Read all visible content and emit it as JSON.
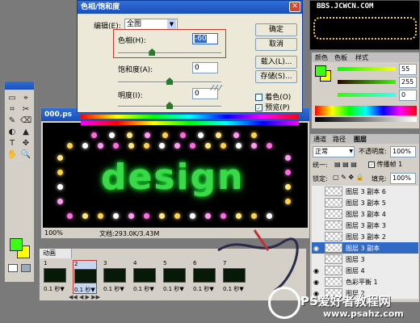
{
  "hue_dialog": {
    "title": "色相/饱和度",
    "edit_label": "编辑(E):",
    "edit_value": "全图",
    "hue_label": "色相(H):",
    "hue_value": "-60",
    "hue_level": 0.33,
    "saturation_label": "饱和度(A):",
    "saturation_value": "0",
    "saturation_level": 0.5,
    "lightness_label": "明度(I):",
    "lightness_value": "0",
    "lightness_level": 0.5,
    "ok_button": "确定",
    "cancel_button": "取消",
    "load_button": "载入(L)...",
    "save_button": "存储(S)...",
    "colorize_label": "着色(O)",
    "colorize_checked": false,
    "preview_label": "预览(P)",
    "preview_checked": true
  },
  "watermark_top": "BBS.JCWCN.COM",
  "document": {
    "title": "000.ps",
    "canvas_text": "design",
    "zoom": "100%",
    "doc_info": "文档:293.0K/3.43M"
  },
  "color_panel": {
    "tabs": [
      "颜色",
      "色板",
      "样式"
    ],
    "value_r": "55",
    "value_g": "255",
    "value_b": "0",
    "foreground": "#39ff14",
    "background": "#ffff00"
  },
  "layers_panel": {
    "tabs": [
      "通道",
      "路径",
      "图层"
    ],
    "blend_mode": "正常",
    "opacity_label": "不透明度:",
    "opacity_value": "100%",
    "unify_label": "统一:",
    "propagate_label": "传播帧 1",
    "lock_label": "锁定:",
    "fill_label": "填充:",
    "fill_value": "100%",
    "layers": [
      {
        "name": "图层 3 副本 6",
        "visible": false,
        "selected": false
      },
      {
        "name": "图层 3 副本 5",
        "visible": false,
        "selected": false
      },
      {
        "name": "图层 3 副本 4",
        "visible": false,
        "selected": false
      },
      {
        "name": "图层 3 副本 3",
        "visible": false,
        "selected": false
      },
      {
        "name": "图层 3 副本 2",
        "visible": false,
        "selected": false
      },
      {
        "name": "图层 3 副本",
        "visible": true,
        "selected": true
      },
      {
        "name": "图层 3",
        "visible": false,
        "selected": false
      },
      {
        "name": "图层 4",
        "visible": true,
        "selected": false
      },
      {
        "name": "色彩平衡 1",
        "visible": true,
        "selected": false
      },
      {
        "name": "图层 2",
        "visible": true,
        "selected": false
      }
    ]
  },
  "animation_panel": {
    "title": "动画",
    "frames": [
      {
        "num": "1",
        "duration": "0.1 秒▼"
      },
      {
        "num": "2",
        "duration": "0.1 秒▼"
      },
      {
        "num": "3",
        "duration": "0.1 秒▼"
      },
      {
        "num": "4",
        "duration": "0.1 秒▼"
      },
      {
        "num": "5",
        "duration": "0.1 秒▼"
      },
      {
        "num": "6",
        "duration": "0.1 秒▼"
      },
      {
        "num": "7",
        "duration": "0.1 秒▼"
      }
    ]
  },
  "watermark_bottom": {
    "line1": "PS爱好者教程网",
    "line2": "www.psahz.com"
  },
  "tools": [
    "▭",
    "⌖",
    "⌗",
    "✂",
    "✎",
    "⌫",
    "◐",
    "▲",
    "T",
    "✥",
    "✋",
    "🔍"
  ]
}
